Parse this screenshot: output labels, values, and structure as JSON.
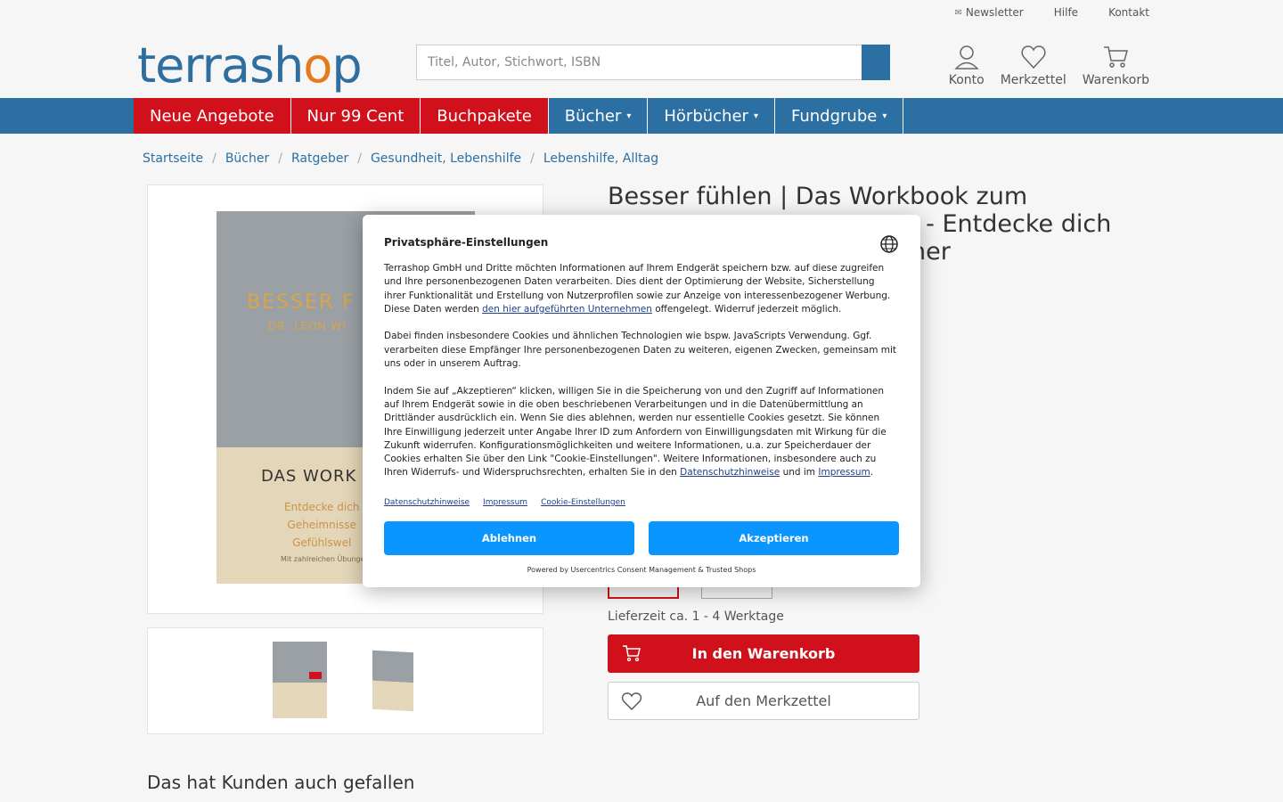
{
  "topbar": {
    "links": [
      {
        "icon": "envelope-icon",
        "glyph": "✉",
        "label": "Newsletter"
      },
      {
        "icon": "help-icon",
        "glyph": "",
        "label": "Hilfe"
      },
      {
        "icon": "contact-icon",
        "glyph": "",
        "label": "Kontakt"
      }
    ]
  },
  "header": {
    "logo": {
      "part1": "terrash",
      "o": "o",
      "part2": "p"
    },
    "search_placeholder": "Titel, Autor, Stichwort, ISBN",
    "search_button_glyph": "",
    "icons": {
      "account": "Konto",
      "wishlist": "Merkzettel",
      "cart": "Warenkorb"
    }
  },
  "nav": {
    "items": [
      "Neue Angebote",
      "Nur 99 Cent",
      "Buchpakete",
      "Bücher",
      "Hörbücher",
      "Fundgrube"
    ],
    "caret": "▾"
  },
  "breadcrumb": {
    "items": [
      "Startseite",
      "Bücher",
      "Ratgeber",
      "Gesundheit, Lebenshilfe",
      "Lebenshilfe, Alltag"
    ],
    "separator": "/"
  },
  "product": {
    "title": "Besser fühlen | Das Workbook zum ... - Entdecke dich ... ner",
    "title_line1": "Besser fühlen | Das Workbook zum",
    "title_line2": ". - Entdecke dich",
    "title_line3": "ner",
    "image_prev_glyph": "",
    "cover": {
      "title": "BESSER F",
      "author": "DR. LEON WI",
      "subtitle": "DAS WORK",
      "tagline1": "Entdecke dich",
      "tagline2": "Geheimnisse",
      "tagline3": "Gefühlswel",
      "note": "Mit zahlreichen Übungen"
    },
    "delivery": "Lieferzeit ca. 1 - 4 Werktage",
    "cart_button": "In den Warenkorb",
    "wishlist_button": "Auf den Merkzettel"
  },
  "related_heading": "Das hat Kunden auch gefallen",
  "consent": {
    "heading": "Privatsphäre-Einstellungen",
    "p1_a": "Terrashop GmbH und Dritte möchten Informationen auf Ihrem Endgerät speichern bzw. auf diese zugreifen und Ihre personenbezogenen Daten verarbeiten. Dies dient der Optimierung der Website, Sicherstellung ihrer Funktionalität und Erstellung von Nutzerprofilen sowie zur Anzeige von interessenbezogener Werbung. Diese Daten werden ",
    "p1_link": "den hier aufgeführten Unternehmen",
    "p1_b": " offengelegt. Widerruf jederzeit möglich.",
    "p2": "Dabei finden insbesondere Cookies und ähnlichen Technologien wie bspw. JavaScripts Verwendung. Ggf. verarbeiten diese Empfänger Ihre personenbezogenen Daten zu weiteren, eigenen Zwecken, gemeinsam mit uns oder in unserem Auftrag.",
    "p3_a": "Indem Sie auf „Akzeptieren“ klicken, willigen Sie in die Speicherung von und den Zugriff auf Informationen auf Ihrem Endgerät sowie in die oben beschriebenen Verarbeitungen und in die Datenübermittlung an Drittländer ausdrücklich ein. Wenn Sie dies ablehnen, werden nur essentielle Cookies gesetzt. Sie können Ihre Einwilligung jederzeit unter Angabe Ihrer ID zum Anfordern von Einwilligungsdaten mit Wirkung für die Zukunft widerrufen. Konfigurationsmöglichkeiten und weitere Informationen, u.a. zur Speicherdauer der Cookies erhalten Sie über den Link \"Cookie-Einstellungen\". Weitere Informationen, insbesondere auch zu Ihren Widerrufs- und Widerspruchsrechten, erhalten Sie in den ",
    "p3_link1": "Datenschutzhinweise",
    "p3_mid": " und im ",
    "p3_link2": "Impressum",
    "p3_end": ".",
    "links": [
      "Datenschutzhinweise",
      "Impressum",
      "Cookie-Einstellungen"
    ],
    "deny": "Ablehnen",
    "accept": "Akzeptieren",
    "powered": "Powered by Usercentrics Consent Management & Trusted Shops",
    "accent_color": "#0a95ff"
  },
  "colors": {
    "brand_blue": "#2c6fa3",
    "brand_red": "#d0111b",
    "logo_orange": "#e47a1c"
  }
}
